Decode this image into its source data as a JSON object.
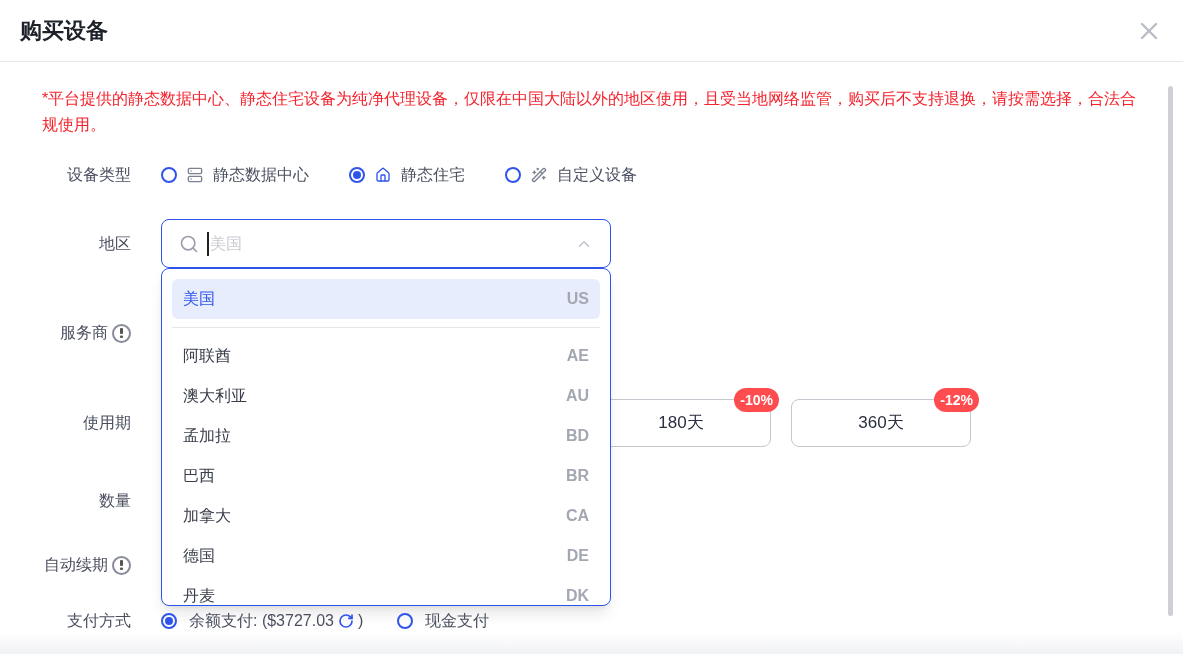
{
  "dialog": {
    "title": "购买设备"
  },
  "notice": "*平台提供的静态数据中心、静态住宅设备为纯净代理设备，仅限在中国大陆以外的地区使用，且受当地网络监管，购买后不支持退换，请按需选择，合法合规使用。",
  "device_type": {
    "label": "设备类型",
    "options": [
      {
        "label": "静态数据中心",
        "kind": "server",
        "selected": false
      },
      {
        "label": "静态住宅",
        "kind": "home",
        "selected": true
      },
      {
        "label": "自定义设备",
        "kind": "wand",
        "selected": false
      }
    ]
  },
  "region": {
    "label": "地区",
    "placeholder": "美国",
    "dropdown": [
      {
        "name": "美国",
        "code": "US",
        "selected": true,
        "pinned": true
      },
      {
        "name": "阿联酋",
        "code": "AE",
        "selected": false,
        "pinned": false
      },
      {
        "name": "澳大利亚",
        "code": "AU",
        "selected": false,
        "pinned": false
      },
      {
        "name": "孟加拉",
        "code": "BD",
        "selected": false,
        "pinned": false
      },
      {
        "name": "巴西",
        "code": "BR",
        "selected": false,
        "pinned": false
      },
      {
        "name": "加拿大",
        "code": "CA",
        "selected": false,
        "pinned": false
      },
      {
        "name": "德国",
        "code": "DE",
        "selected": false,
        "pinned": false
      },
      {
        "name": "丹麦",
        "code": "DK",
        "selected": false,
        "pinned": false
      }
    ]
  },
  "provider": {
    "label": "服务商"
  },
  "period": {
    "label": "使用期",
    "options": [
      {
        "label": "180天",
        "discount": "-10%"
      },
      {
        "label": "360天",
        "discount": "-12%"
      }
    ]
  },
  "quantity": {
    "label": "数量"
  },
  "auto_renew": {
    "label": "自动续期"
  },
  "payment": {
    "label": "支付方式",
    "options": [
      {
        "label": "余额支付: ($3727.03",
        "suffix": ")",
        "refresh": true,
        "selected": true
      },
      {
        "label": "现金支付",
        "refresh": false,
        "selected": false
      }
    ]
  }
}
